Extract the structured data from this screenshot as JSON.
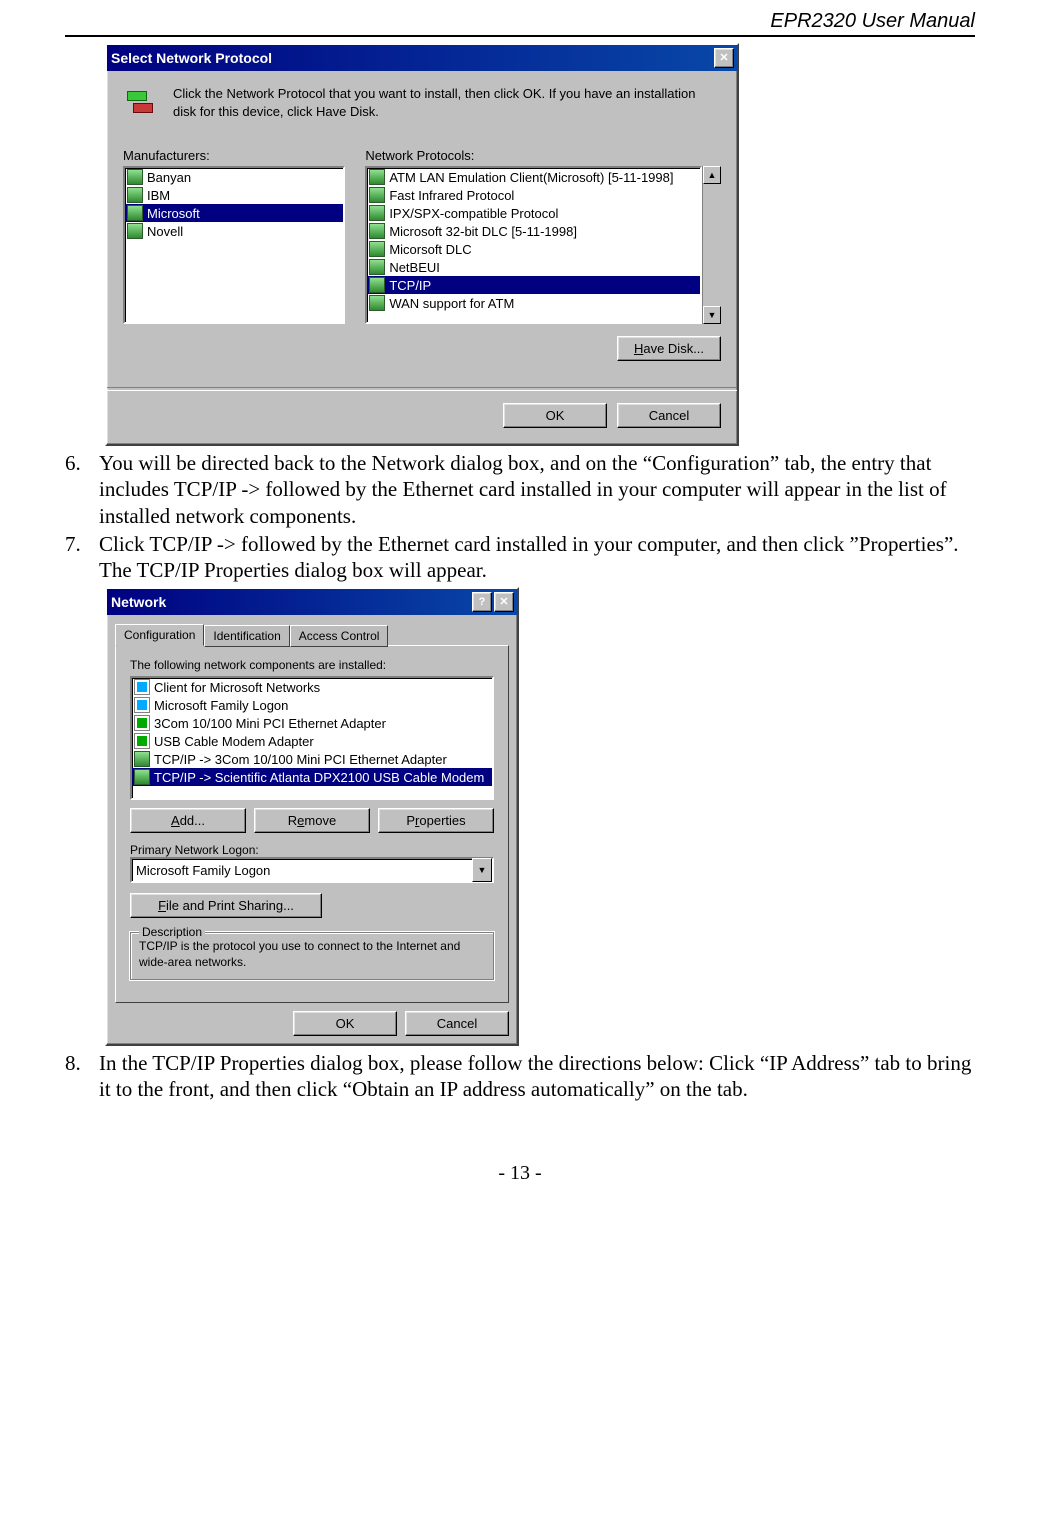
{
  "header": {
    "model": "EPR2320",
    "title": "User Manual"
  },
  "footer": {
    "page_number": "- 13 -"
  },
  "steps": {
    "six": {
      "num": "6",
      "text": "You will be directed back to the Network dialog box, and on the “Configuration” tab, the entry that includes TCP/IP -> followed by the Ethernet card installed in your computer will appear in the list of installed network components."
    },
    "seven": {
      "num": "7",
      "text": "Click TCP/IP -> followed by the Ethernet card installed in your computer, and then click ”Properties”. The TCP/IP Properties dialog box will appear."
    },
    "eight": {
      "num": "8",
      "text": "In the TCP/IP Properties dialog box, please follow the directions below: Click “IP Address” tab to bring it to the front, and then click “Obtain an IP address automatically” on the tab."
    }
  },
  "dialog1": {
    "title": "Select Network Protocol",
    "hint": "Click the Network Protocol that you want to install, then click OK. If you have an installation disk for this device, click Have Disk.",
    "label_manufacturers": "Manufacturers:",
    "label_protocols": "Network Protocols:",
    "have_disk": "Have Disk...",
    "ok": "OK",
    "cancel": "Cancel",
    "manufacturers": [
      "Banyan",
      "IBM",
      "Microsoft",
      "Novell"
    ],
    "manufacturer_selected": 2,
    "protocols": [
      "ATM LAN Emulation Client(Microsoft) [5-11-1998]",
      "Fast Infrared Protocol",
      "IPX/SPX-compatible Protocol",
      "Microsoft 32-bit DLC       [5-11-1998]",
      "Micorsoft DLC",
      "NetBEUI",
      "TCP/IP",
      "WAN support for ATM"
    ],
    "protocol_selected": 6
  },
  "dialog2": {
    "title": "Network",
    "tabs": [
      "Configuration",
      "Identification",
      "Access Control"
    ],
    "active_tab": 0,
    "list_label": "The following network components are installed:",
    "components": [
      {
        "icon": "client",
        "text": "Client for Microsoft Networks"
      },
      {
        "icon": "client",
        "text": "Microsoft Family Logon"
      },
      {
        "icon": "adapter",
        "text": "3Com 10/100 Mini PCI Ethernet Adapter"
      },
      {
        "icon": "adapter",
        "text": "USB Cable Modem Adapter"
      },
      {
        "icon": "proto",
        "text": "TCP/IP -> 3Com 10/100 Mini PCI Ethernet Adapter"
      },
      {
        "icon": "proto",
        "text": "TCP/IP -> Scientific Atlanta DPX2100 USB Cable Modem"
      }
    ],
    "component_selected": 5,
    "add": "Add...",
    "remove": "Remove",
    "properties": "Properties",
    "primary_label": "Primary Network Logon:",
    "primary_value": "Microsoft Family Logon",
    "file_print": "File and Print Sharing...",
    "description_legend": "Description",
    "description_text": "TCP/IP is the protocol you use to connect to the Internet and wide-area networks.",
    "ok": "OK",
    "cancel": "Cancel"
  }
}
